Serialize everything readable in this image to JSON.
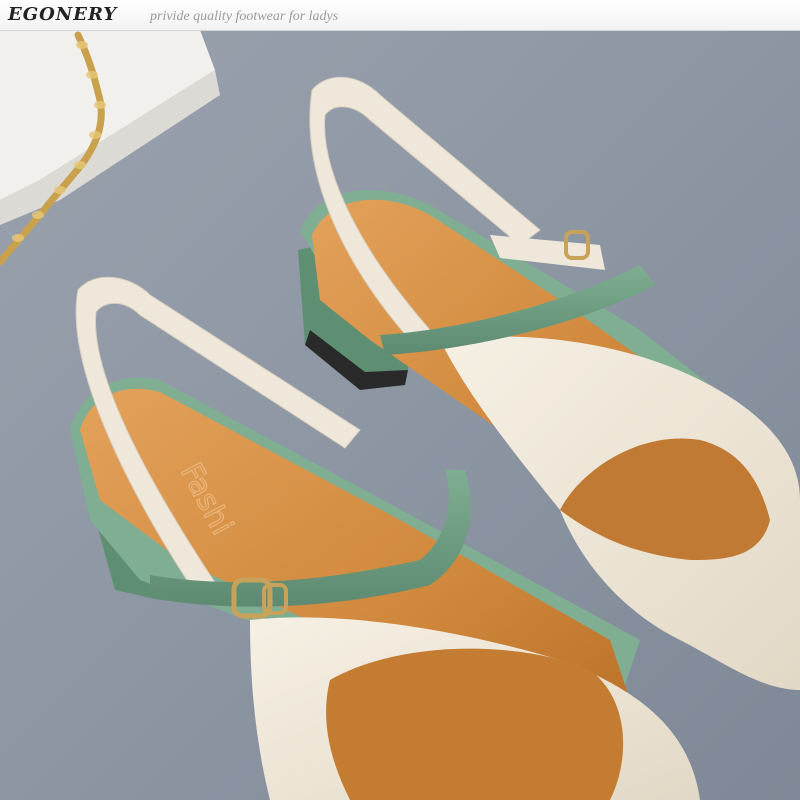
{
  "header": {
    "brand": "EGONERY",
    "tagline": "privide quality footwear for ladys"
  },
  "insole_print": "Fashi",
  "colors": {
    "backdrop": "#8f98a5",
    "cream_leather": "#efe7d9",
    "insole_tan": "#d08a3e",
    "mint_strap": "#6f9c82",
    "gold_buckle": "#c8a25a"
  },
  "photo_subject": "pair of cream and mint slingback block-heel shoes with buckle straps"
}
